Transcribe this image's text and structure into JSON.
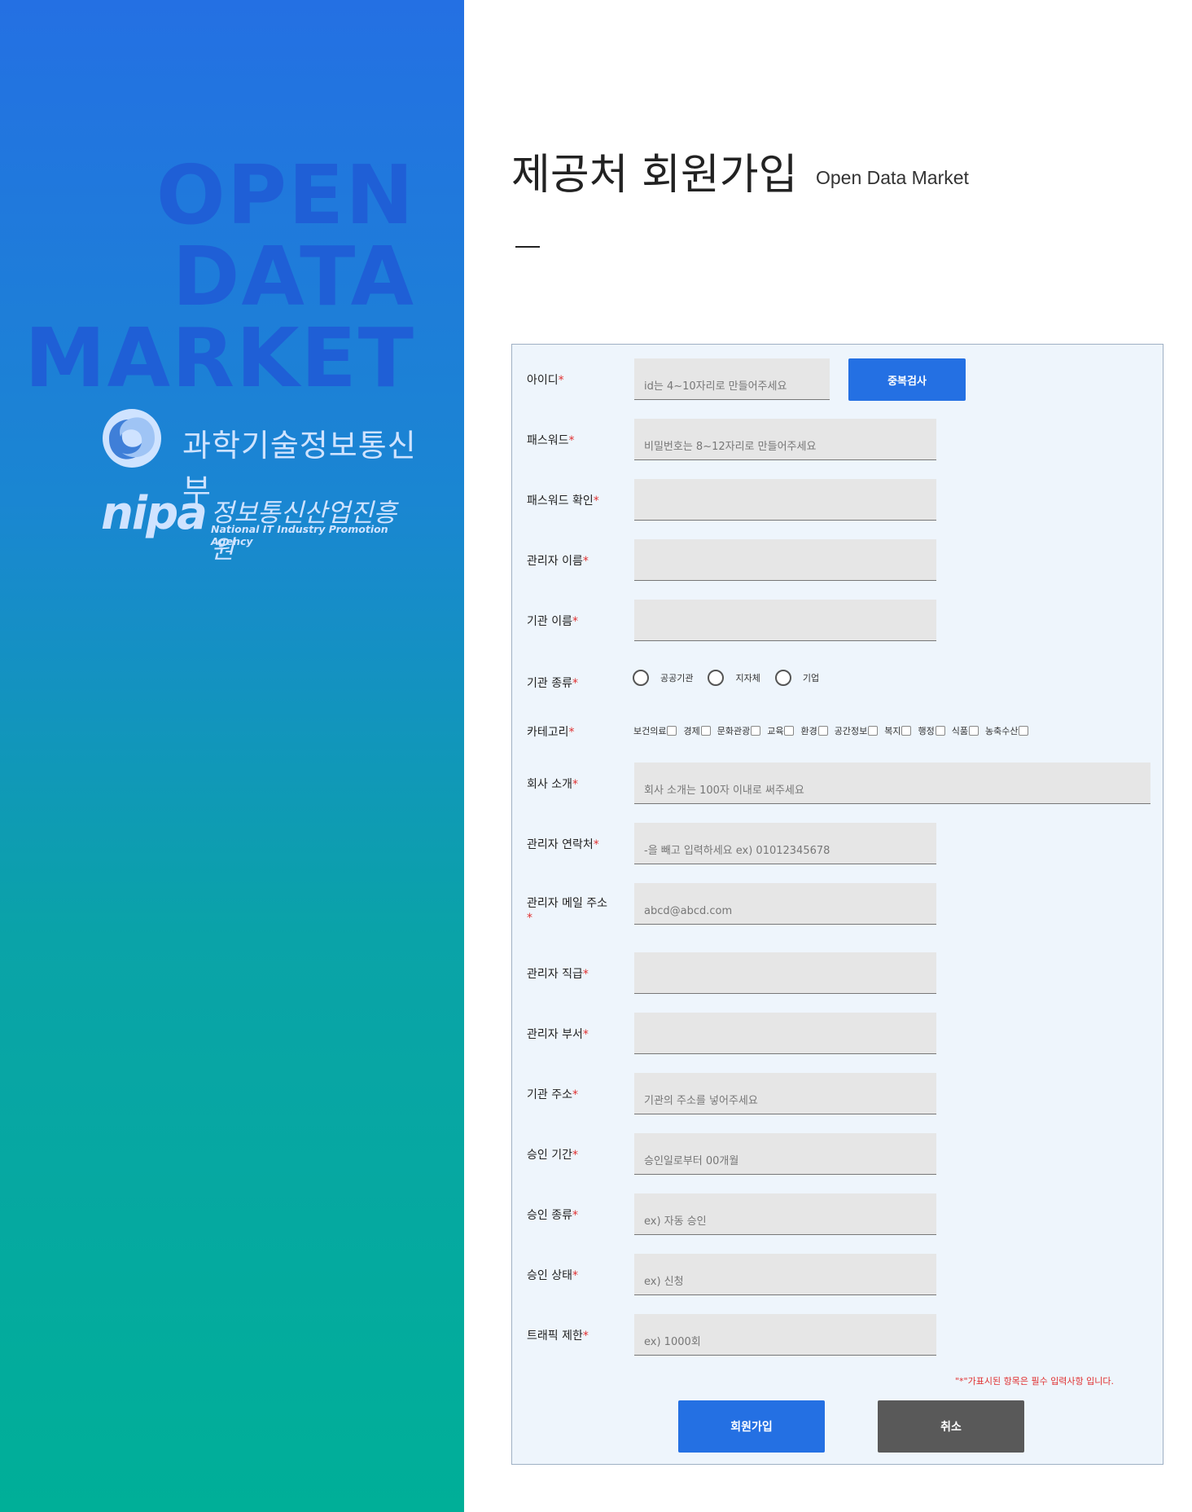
{
  "brand": {
    "line1": "OPEN",
    "line2": "DATA",
    "line3": "MARKET",
    "ministry": "과학기술정보통신부",
    "nipa_word": "nipa",
    "nipa_kr": "정보통신산업진흥원",
    "nipa_en": "National IT Industry Promotion Agency"
  },
  "page": {
    "title": "제공처 회원가입",
    "subtitle": "Open Data Market"
  },
  "required_mark": "*",
  "form": {
    "id": {
      "label": "아이디",
      "placeholder": "id는 4~10자리로 만들어주세요",
      "check_button": "중복검사"
    },
    "password": {
      "label": "패스워드",
      "placeholder": "비밀번호는 8~12자리로 만들어주세요"
    },
    "password_confirm": {
      "label": "패스워드 확인",
      "placeholder": ""
    },
    "manager_name": {
      "label": "관리자 이름",
      "placeholder": ""
    },
    "org_name": {
      "label": "기관 이름",
      "placeholder": ""
    },
    "org_type": {
      "label": "기관 종류",
      "options": [
        "공공기관",
        "지자체",
        "기업"
      ]
    },
    "category": {
      "label": "카테고리",
      "options": [
        "보건의료",
        "경제",
        "문화관광",
        "교육",
        "환경",
        "공간정보",
        "복지",
        "행정",
        "식품",
        "농축수산"
      ]
    },
    "company_intro": {
      "label": "회사 소개",
      "placeholder": "회사 소개는 100자 이내로 써주세요"
    },
    "manager_phone": {
      "label": "관리자 연락처",
      "placeholder": "-을 빼고 입력하세요 ex) 01012345678"
    },
    "manager_email": {
      "label": "관리자 메일 주소",
      "placeholder": "abcd@abcd.com"
    },
    "manager_position": {
      "label": "관리자 직급",
      "placeholder": ""
    },
    "manager_dept": {
      "label": "관리자 부서",
      "placeholder": ""
    },
    "org_address": {
      "label": "기관 주소",
      "placeholder": "기관의 주소를 넣어주세요"
    },
    "approval_period": {
      "label": "승인 기간",
      "placeholder": "승인일로부터 00개월"
    },
    "approval_type": {
      "label": "승인 종류",
      "placeholder": "ex) 자동 승인"
    },
    "approval_status": {
      "label": "승인 상태",
      "placeholder": "ex) 신청"
    },
    "traffic_limit": {
      "label": "트래픽 제한",
      "placeholder": "ex) 1000회"
    },
    "required_note": "\"*\"가표시된 항목은 필수 입력사항 입니다.",
    "submit_button": "회원가입",
    "cancel_button": "취소"
  },
  "colors": {
    "accent": "#2470e3",
    "required": "#e03030",
    "cancel": "#595959",
    "form_bg": "#eef5fc"
  }
}
